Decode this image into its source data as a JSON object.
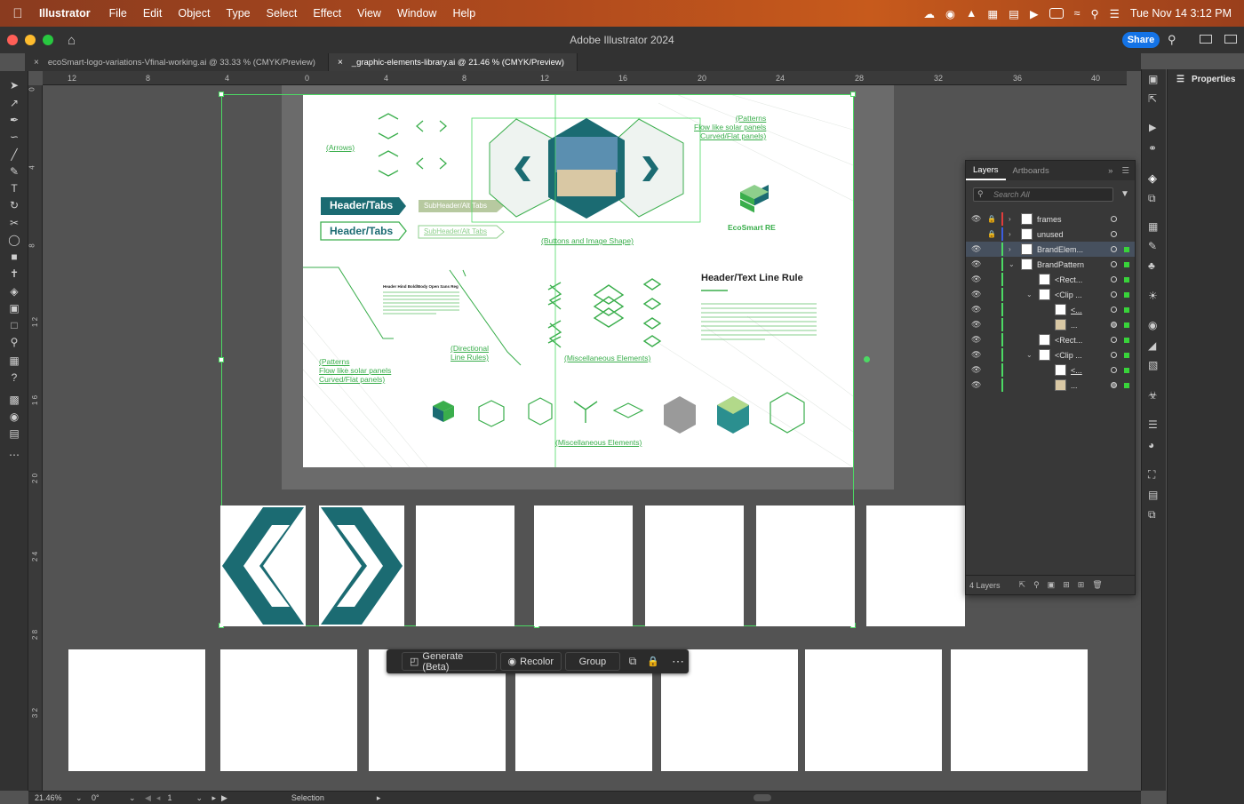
{
  "menubar": {
    "app": "Illustrator",
    "items": [
      "File",
      "Edit",
      "Object",
      "Type",
      "Select",
      "Effect",
      "View",
      "Window",
      "Help"
    ],
    "clock": "Tue Nov 14  3:12 PM"
  },
  "window": {
    "title": "Adobe Illustrator 2024",
    "share_label": "Share"
  },
  "tabs": [
    {
      "label": "ecoSmart-logo-variations-Vfinal-working.ai @ 33.33 % (CMYK/Preview)"
    },
    {
      "label": "_graphic-elements-library.ai @ 21.46 % (CMYK/Preview)"
    }
  ],
  "ruler_top": [
    "12",
    "8",
    "4",
    "0",
    "4",
    "8",
    "12",
    "16",
    "20",
    "24",
    "28",
    "32",
    "36",
    "40"
  ],
  "ruler_left": [
    "0",
    "4",
    "8",
    "1\n2",
    "1\n6",
    "2\n0",
    "2\n4",
    "2\n8",
    "3\n2"
  ],
  "props_panel": {
    "title": "Properties"
  },
  "layers_panel": {
    "tabs": [
      "Layers",
      "Artboards"
    ],
    "search_placeholder": "Search All",
    "rows": [
      {
        "name": "frames"
      },
      {
        "name": "unused"
      },
      {
        "name": "BrandElem..."
      },
      {
        "name": "BrandPattern"
      },
      {
        "name": "<Rect..."
      },
      {
        "name": "<Clip ..."
      },
      {
        "name": "<..."
      },
      {
        "name": "..."
      },
      {
        "name": "<Rect..."
      },
      {
        "name": "<Clip ..."
      },
      {
        "name": "<..."
      },
      {
        "name": "..."
      }
    ],
    "count": "4 Layers"
  },
  "artwork": {
    "arrows_label": "(Arrows)",
    "patterns_label_1": "(Patterns\nFlow like solar panels\nCurved/Flat panels)",
    "patterns_label_2": "(Patterns\nFlow like solar panels\nCurved/Flat panels)",
    "header_tab_1": "Header/Tabs",
    "header_tab_2": "Header/Tabs",
    "subheader_1": "SubHeader/Alt Tabs",
    "subheader_2": "SubHeader/Alt Tabs",
    "buttons_label": "(Buttons and Image Shape)",
    "brand_name": "EcoSmart RE",
    "header_text_rule": "Header/Text Line Rule",
    "header_hind": "Header Hind Bold/Body Open Sans Reg",
    "directional_label": "(Directional\nLine Rules)",
    "misc_label_1": "(Miscellaneous Elements)",
    "misc_label_2": "(Miscellaneous Elements)"
  },
  "contextbar": {
    "generate": "Generate (Beta)",
    "recolor": "Recolor",
    "group": "Group"
  },
  "statusbar": {
    "zoom": "21.46%",
    "rotate": "0°",
    "artboard": "1",
    "mode": "Selection"
  },
  "colors": {
    "brand_teal": "#1b6b72",
    "brand_green": "#3aae4c",
    "selection": "#4cd964"
  }
}
